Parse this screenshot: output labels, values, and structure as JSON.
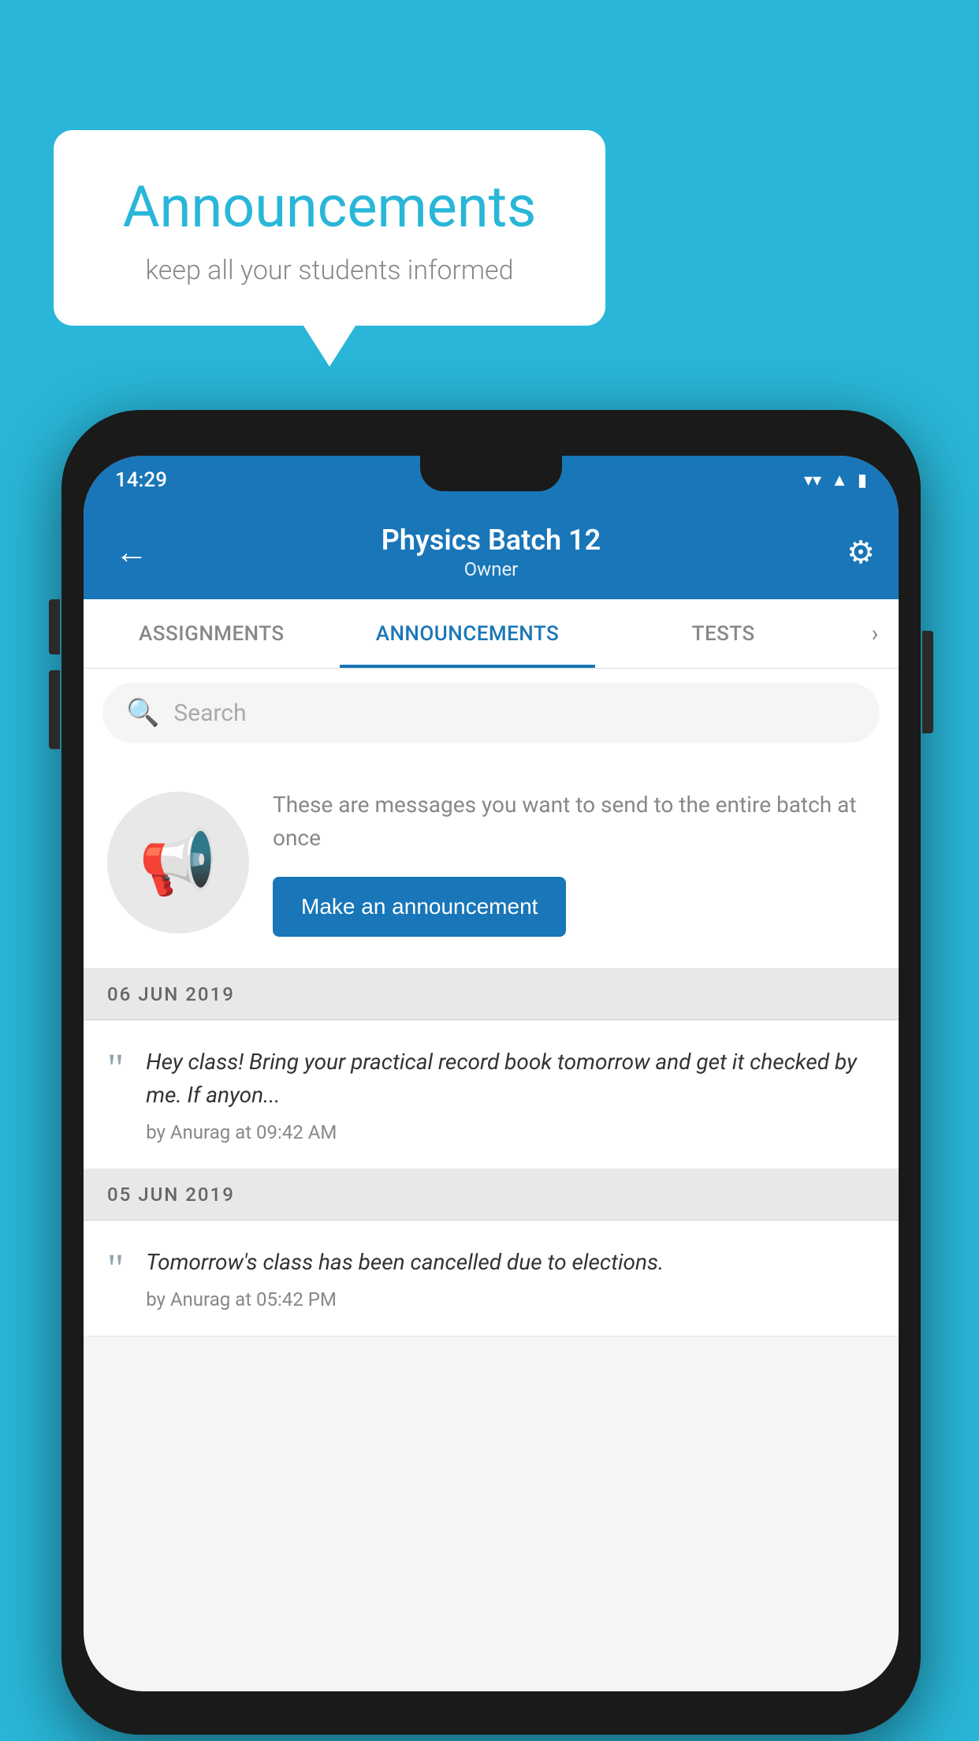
{
  "background_color": "#29b6d8",
  "speech_bubble": {
    "title": "Announcements",
    "subtitle": "keep all your students informed"
  },
  "phone": {
    "status_bar": {
      "time": "14:29",
      "icons": [
        "wifi",
        "signal",
        "battery"
      ]
    },
    "app_bar": {
      "title": "Physics Batch 12",
      "subtitle": "Owner",
      "back_label": "←",
      "settings_label": "⚙"
    },
    "tabs": [
      {
        "label": "ASSIGNMENTS",
        "active": false
      },
      {
        "label": "ANNOUNCEMENTS",
        "active": true
      },
      {
        "label": "TESTS",
        "active": false
      }
    ],
    "search": {
      "placeholder": "Search"
    },
    "promo": {
      "description": "These are messages you want to send to the entire batch at once",
      "button_label": "Make an announcement"
    },
    "announcements": [
      {
        "date": "06  JUN  2019",
        "items": [
          {
            "text": "Hey class! Bring your practical record book tomorrow and get it checked by me. If anyon...",
            "author": "by Anurag at 09:42 AM"
          }
        ]
      },
      {
        "date": "05  JUN  2019",
        "items": [
          {
            "text": "Tomorrow's class has been cancelled due to elections.",
            "author": "by Anurag at 05:42 PM"
          }
        ]
      }
    ]
  }
}
